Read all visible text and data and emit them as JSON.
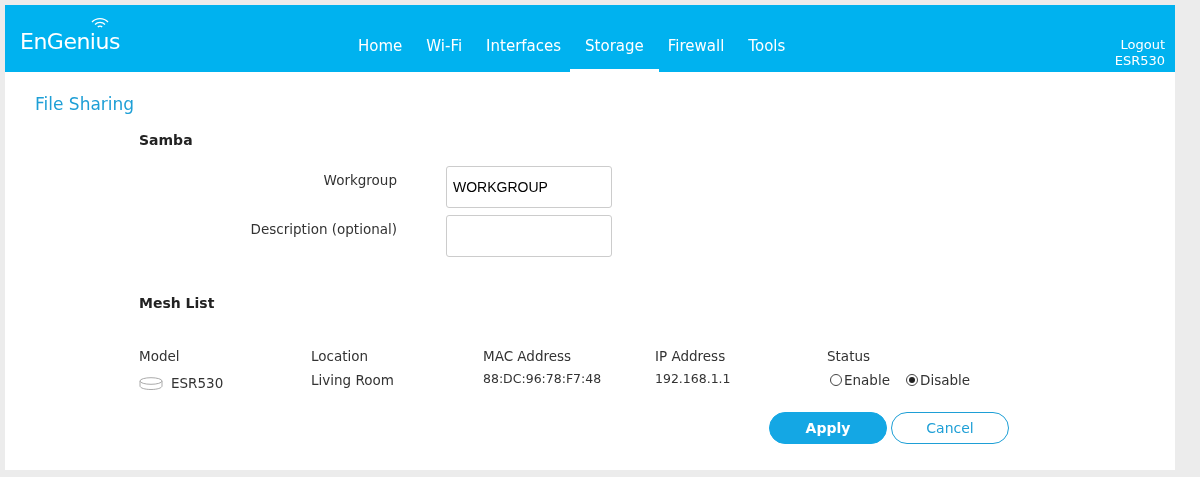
{
  "header": {
    "logo": "EnGenius",
    "nav": [
      {
        "label": "Home",
        "selected": false
      },
      {
        "label": "Wi-Fi",
        "selected": false
      },
      {
        "label": "Interfaces",
        "selected": false
      },
      {
        "label": "Storage",
        "selected": true
      },
      {
        "label": "Firewall",
        "selected": false
      },
      {
        "label": "Tools",
        "selected": false
      }
    ],
    "logout": "Logout",
    "device": "ESR530"
  },
  "page_title": "File Sharing",
  "samba": {
    "heading": "Samba",
    "fields": [
      {
        "label": "Workgroup",
        "value": "WORKGROUP"
      },
      {
        "label": "Description (optional)"
      }
    ]
  },
  "mesh_list": {
    "heading": "Mesh List",
    "columns": [
      "Model",
      "Location",
      "MAC Address",
      "IP Address",
      "Status"
    ],
    "rows": [
      {
        "model": "ESR530",
        "location": "Living Room",
        "mac": "88:DC:96:78:F7:48",
        "ip": "192.168.1.1",
        "status_options": [
          {
            "label": "Enable",
            "selected": false
          },
          {
            "label": "Disable",
            "selected": true
          }
        ]
      }
    ]
  },
  "buttons": [
    {
      "label": "Apply",
      "kind": "primary"
    },
    {
      "label": "Cancel",
      "kind": "outline"
    }
  ]
}
